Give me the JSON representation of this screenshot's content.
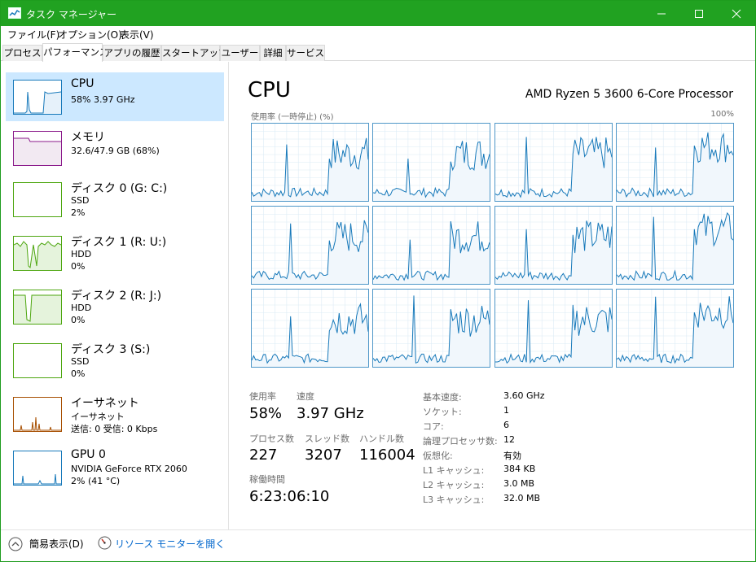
{
  "window": {
    "title": "タスク マネージャー"
  },
  "menu": [
    "ファイル(F)",
    "オプション(O)",
    "表示(V)"
  ],
  "tabs": [
    {
      "label": "プロセス",
      "active": false
    },
    {
      "label": "パフォーマンス",
      "active": true
    },
    {
      "label": "アプリの履歴",
      "active": false
    },
    {
      "label": "スタートアップ",
      "active": false
    },
    {
      "label": "ユーザー",
      "active": false
    },
    {
      "label": "詳細",
      "active": false
    },
    {
      "label": "サービス",
      "active": false
    }
  ],
  "sidebar": {
    "items": [
      {
        "title": "CPU",
        "line1": "58%  3.97 GHz",
        "line2": "",
        "color": "#1779ba",
        "selected": true
      },
      {
        "title": "メモリ",
        "line1": "32.6/47.9 GB (68%)",
        "line2": "",
        "color": "#8b1a8b",
        "selected": false
      },
      {
        "title": "ディスク 0 (G: C:)",
        "line1": "SSD",
        "line2": "2%",
        "color": "#4da60f",
        "selected": false
      },
      {
        "title": "ディスク 1 (R: U:)",
        "line1": "HDD",
        "line2": "0%",
        "color": "#4da60f",
        "selected": false
      },
      {
        "title": "ディスク 2 (R: J:)",
        "line1": "HDD",
        "line2": "0%",
        "color": "#4da60f",
        "selected": false
      },
      {
        "title": "ディスク 3 (S:)",
        "line1": "SSD",
        "line2": "0%",
        "color": "#4da60f",
        "selected": false
      },
      {
        "title": "イーサネット",
        "line1": "イーサネット",
        "line2": "送信: 0  受信: 0 Kbps",
        "color": "#a74f01",
        "selected": false
      },
      {
        "title": "GPU 0",
        "line1": "NVIDIA GeForce RTX 2060",
        "line2": "2%  (41 °C)",
        "color": "#1779ba",
        "selected": false
      }
    ]
  },
  "main": {
    "title": "CPU",
    "processor": "AMD Ryzen 5 3600 6-Core Processor",
    "graph_caption": "使用率 (一時停止) (%)",
    "graph_max": "100%",
    "accent": "#1779ba",
    "stats": {
      "utilization_label": "使用率",
      "utilization_value": "58%",
      "speed_label": "速度",
      "speed_value": "3.97 GHz",
      "processes_label": "プロセス数",
      "processes_value": "227",
      "threads_label": "スレッド数",
      "threads_value": "3207",
      "handles_label": "ハンドル数",
      "handles_value": "116004",
      "uptime_label": "稼働時間",
      "uptime_value": "6:23:06:10"
    },
    "specs": [
      {
        "label": "基本速度:",
        "value": "3.60 GHz"
      },
      {
        "label": "ソケット:",
        "value": "1"
      },
      {
        "label": "コア:",
        "value": "6"
      },
      {
        "label": "論理プロセッサ数:",
        "value": "12"
      },
      {
        "label": "仮想化:",
        "value": "有効"
      },
      {
        "label": "L1 キャッシュ:",
        "value": "384 KB"
      },
      {
        "label": "L2 キャッシュ:",
        "value": "3.0 MB"
      },
      {
        "label": "L3 キャッシュ:",
        "value": "32.0 MB"
      }
    ]
  },
  "footer": {
    "fewer_details": "簡易表示(D)",
    "open_resmon": "リソース モニターを開く"
  }
}
